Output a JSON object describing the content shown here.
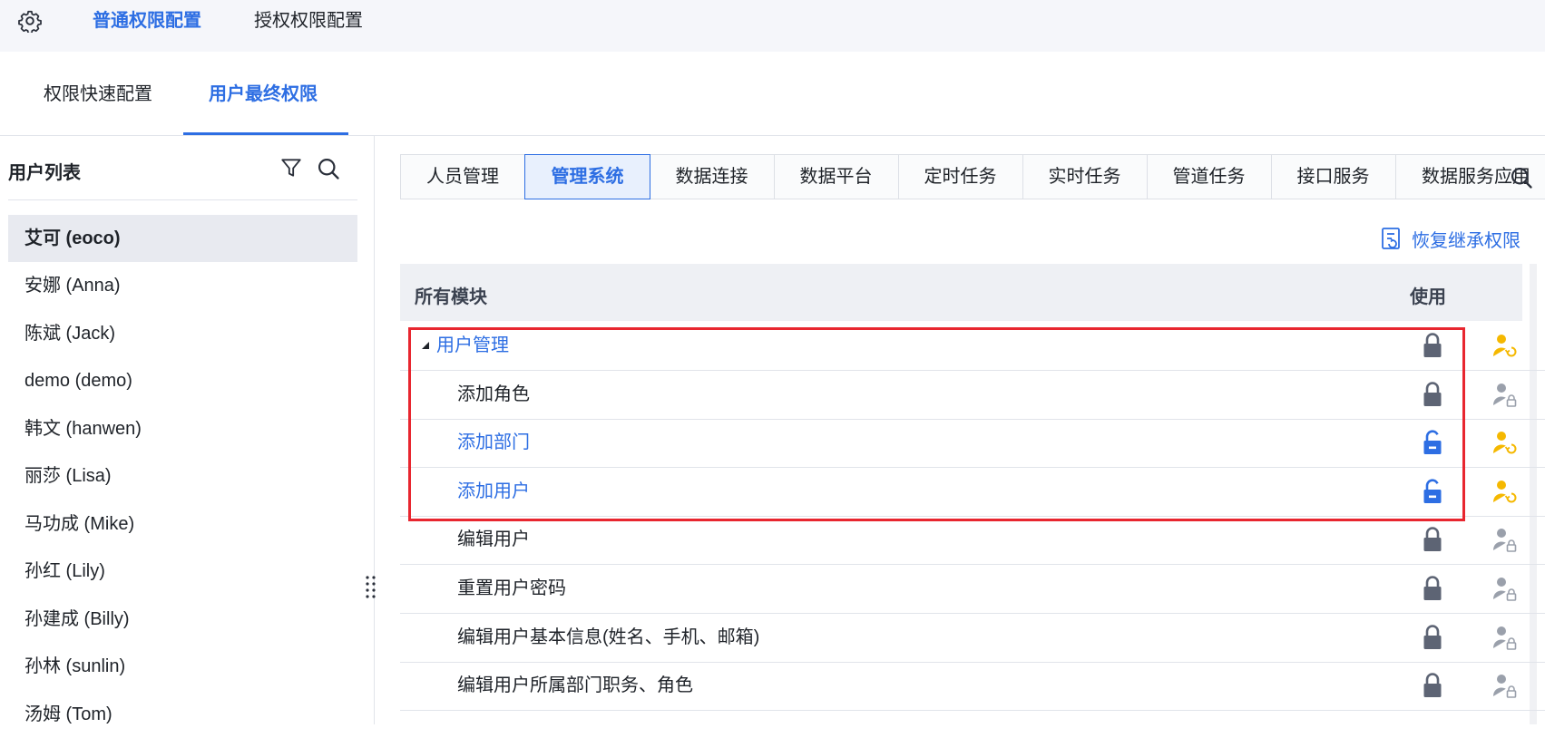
{
  "top_tabs": [
    "普通权限配置",
    "授权权限配置"
  ],
  "sub_tabs": [
    "权限快速配置",
    "用户最终权限"
  ],
  "user_list": {
    "title": "用户列表",
    "users": [
      "艾可 (eoco)",
      "安娜 (Anna)",
      "陈斌 (Jack)",
      "demo (demo)",
      "韩文 (hanwen)",
      "丽莎 (Lisa)",
      "马功成 (Mike)",
      "孙红 (Lily)",
      "孙建成 (Billy)",
      "孙林 (sunlin)",
      "汤姆 (Tom)"
    ]
  },
  "module_tabs": [
    "人员管理",
    "管理系统",
    "数据连接",
    "数据平台",
    "定时任务",
    "实时任务",
    "管道任务",
    "接口服务",
    "数据服务应用"
  ],
  "restore_label": "恢复继承权限",
  "table": {
    "col_module": "所有模块",
    "col_use": "使用",
    "rows": [
      {
        "label": "用户管理",
        "lock": "locked",
        "person": "inherited"
      },
      {
        "label": "添加角色",
        "lock": "locked",
        "person": "locked"
      },
      {
        "label": "添加部门",
        "lock": "unlocked",
        "person": "inherited"
      },
      {
        "label": "添加用户",
        "lock": "unlocked",
        "person": "inherited"
      },
      {
        "label": "编辑用户",
        "lock": "locked",
        "person": "locked"
      },
      {
        "label": "重置用户密码",
        "lock": "locked",
        "person": "locked"
      },
      {
        "label": "编辑用户基本信息(姓名、手机、邮箱)",
        "lock": "locked",
        "person": "locked"
      },
      {
        "label": "编辑用户所属部门职务、角色",
        "lock": "locked",
        "person": "locked"
      }
    ]
  },
  "colors": {
    "accent": "#2d6ee3",
    "highlight": "#e8262f",
    "lock_gray": "#5d6474",
    "person_gold": "#f5b800",
    "person_gray": "#9aa0ab"
  }
}
